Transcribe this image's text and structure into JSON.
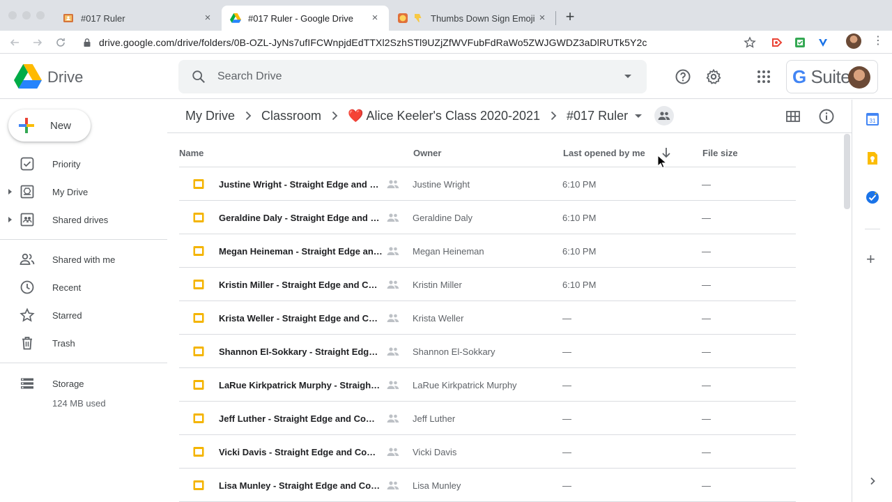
{
  "browser": {
    "tabs": [
      {
        "title": "#017 Ruler",
        "favicon": "classroom-favicon",
        "active": false
      },
      {
        "title": "#017 Ruler - Google Drive",
        "favicon": "drive-favicon",
        "active": true
      },
      {
        "title": "Thumbs Down Sign Emoji",
        "favicon": "emoji-favicon",
        "active": false
      }
    ],
    "close_glyph": "×",
    "new_tab_glyph": "+",
    "url": "drive.google.com/drive/folders/0B-OZL-JyNs7ufIFCWnpjdEdTTXl2SzhSTl9UZjZfWVFubFdRaWo5ZWJGWDZ3aDlRUTk5Y2c",
    "menu_glyph": "⋮"
  },
  "header": {
    "app_name": "Drive",
    "search_placeholder": "Search Drive",
    "suite_name": "Suite",
    "suite_g": "G"
  },
  "sidebar": {
    "new_label": "New",
    "items": [
      {
        "label": "Priority",
        "icon": "priority-icon"
      },
      {
        "label": "My Drive",
        "icon": "my-drive-icon",
        "expandable": true
      },
      {
        "label": "Shared drives",
        "icon": "shared-drives-icon",
        "expandable": true
      },
      {
        "label": "Shared with me",
        "icon": "shared-with-me-icon"
      },
      {
        "label": "Recent",
        "icon": "clock-icon"
      },
      {
        "label": "Starred",
        "icon": "star-icon"
      },
      {
        "label": "Trash",
        "icon": "trash-icon"
      },
      {
        "label": "Storage",
        "icon": "storage-icon"
      }
    ],
    "storage_used": "124 MB used"
  },
  "breadcrumb": {
    "items": [
      "My Drive",
      "Classroom",
      "Alice Keeler's Class 2020-2021",
      "#017 Ruler"
    ],
    "heart": "❤️"
  },
  "table": {
    "columns": {
      "name": "Name",
      "owner": "Owner",
      "last_opened": "Last opened by me",
      "size": "File size"
    },
    "rows": [
      {
        "name": "Justine Wright - Straight Edge and Co...",
        "owner": "Justine Wright",
        "opened": "6:10 PM",
        "size": "—"
      },
      {
        "name": "Geraldine Daly - Straight Edge and Co...",
        "owner": "Geraldine Daly",
        "opened": "6:10 PM",
        "size": "—"
      },
      {
        "name": "Megan Heineman - Straight Edge and ...",
        "owner": "Megan Heineman",
        "opened": "6:10 PM",
        "size": "—"
      },
      {
        "name": "Kristin Miller - Straight Edge and Com...",
        "owner": "Kristin Miller",
        "opened": "6:10 PM",
        "size": "—"
      },
      {
        "name": "Krista Weller - Straight Edge and Com...",
        "owner": "Krista Weller",
        "opened": "—",
        "size": "—"
      },
      {
        "name": "Shannon El-Sokkary - Straight Edge an...",
        "owner": "Shannon El-Sokkary",
        "opened": "—",
        "size": "—"
      },
      {
        "name": "LaRue Kirkpatrick Murphy - Straight Ed...",
        "owner": "LaRue Kirkpatrick Murphy",
        "opened": "—",
        "size": "—"
      },
      {
        "name": "Jeff Luther - Straight Edge and Compa...",
        "owner": "Jeff Luther",
        "opened": "—",
        "size": "—"
      },
      {
        "name": "Vicki Davis - Straight Edge and Compa...",
        "owner": "Vicki Davis",
        "opened": "—",
        "size": "—"
      },
      {
        "name": "Lisa Munley - Straight Edge and Comp...",
        "owner": "Lisa Munley",
        "opened": "—",
        "size": "—"
      }
    ]
  },
  "side_panel": {
    "calendar_day": "31",
    "add_glyph": "+"
  },
  "colors": {
    "accent_blue": "#1a73e8",
    "slides_yellow": "#f4b400",
    "divider": "#dadce0"
  }
}
